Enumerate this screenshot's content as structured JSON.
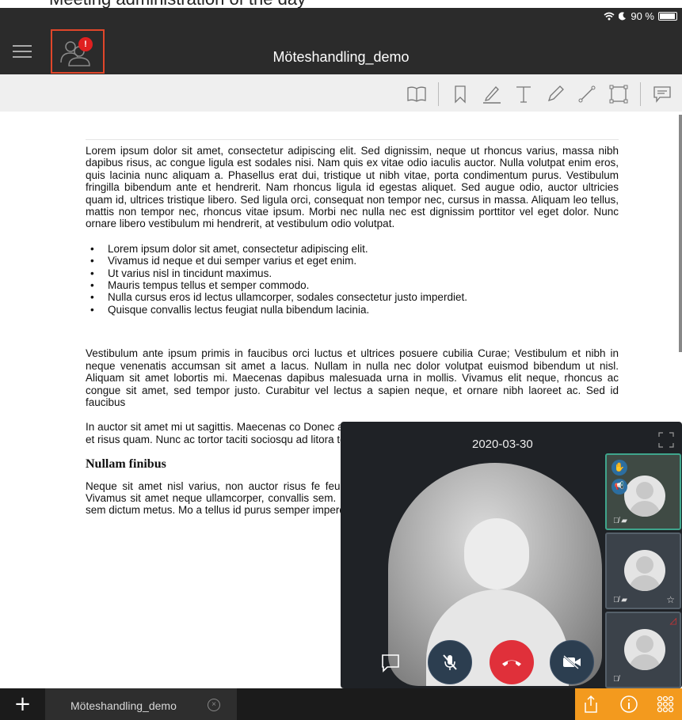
{
  "caption": {
    "text": "Meeting  administration  of  the  day"
  },
  "status_bar": {
    "battery": "90 %"
  },
  "header": {
    "title": "Möteshandling_demo",
    "alert_badge": "!"
  },
  "toolbar": {
    "tools": [
      "book-icon",
      "bookmark-icon",
      "underline-icon",
      "text-icon",
      "pencil-icon",
      "line-icon",
      "rectangle-icon",
      "comment-icon"
    ]
  },
  "document": {
    "para1": "Lorem ipsum dolor sit amet, consectetur adipiscing elit. Sed dignissim, neque ut rhoncus varius, massa nibh dapibus risus, ac congue ligula est sodales nisi. Nam quis ex vitae odio iaculis auctor. Nulla volutpat enim eros, quis lacinia nunc aliquam a. Phasellus erat dui, tristique ut nibh vitae, porta condimentum purus. Vestibulum fringilla bibendum ante et hendrerit. Nam rhoncus ligula id egestas aliquet. Sed augue odio, auctor ultricies quam id, ultrices tristique libero. Sed ligula orci, consequat non tempor nec, cursus in massa. Aliquam leo tellus, mattis non tempor nec, rhoncus vitae ipsum. Morbi nec nulla nec est dignissim porttitor vel eget dolor. Nunc ornare libero vestibulum mi hendrerit, at vestibulum odio volutpat.",
    "bullets": [
      "Lorem ipsum dolor sit amet, consectetur adipiscing elit.",
      "Vivamus id neque et dui semper varius et eget enim.",
      "Ut varius nisl in tincidunt maximus.",
      "Mauris tempus tellus et semper commodo.",
      "Nulla cursus eros id lectus ullamcorper, sodales consectetur justo imperdiet.",
      "Quisque convallis lectus feugiat nulla bibendum lacinia."
    ],
    "para2": "Vestibulum ante ipsum primis in faucibus orci luctus et ultrices posuere cubilia Curae; Vestibulum et nibh in neque venenatis accumsan sit amet a lacus. Nullam in nulla nec dolor volutpat euismod bibendum ut nisl. Aliquam sit amet lobortis mi. Maecenas dapibus malesuada urna in mollis. Vivamus elit neque, rhoncus ac congue sit amet, sed tempor justo. Curabitur vel lectus a sapien neque, et ornare nibh laoreet ac. Sed id faucibus",
    "para3": "In auctor sit amet mi ut sagittis. Maecenas co Donec at ante et mi ultricies laoreet. Maecenas v euismod. Integer et risus quam. Nunc ac tortor taciti sociosqu ad litora torquent per conubia no enim.",
    "heading": "Nullam finibus",
    "para4": "Neque sit amet nisl varius, non auctor risus fe feugiat et et erat. Nulla interdum ut urna ut ultrice laoreet. Vivamus sit amet neque ullamcorper, convallis sem. Ut fermentum ultrices varius. Cr porta eros, in placerat mi sem dictum metus. Mo a tellus id purus semper imperdiet sed in nunc semper magna."
  },
  "video": {
    "date": "2020-03-30"
  },
  "bottom_bar": {
    "add": "+",
    "tab_label": "Möteshandling_demo",
    "tab_close": "×"
  },
  "colors": {
    "accent_orange": "#f39a1e",
    "hangup_red": "#e0303a",
    "alert_red": "#e02020",
    "highlight_border": "#e0462a"
  }
}
